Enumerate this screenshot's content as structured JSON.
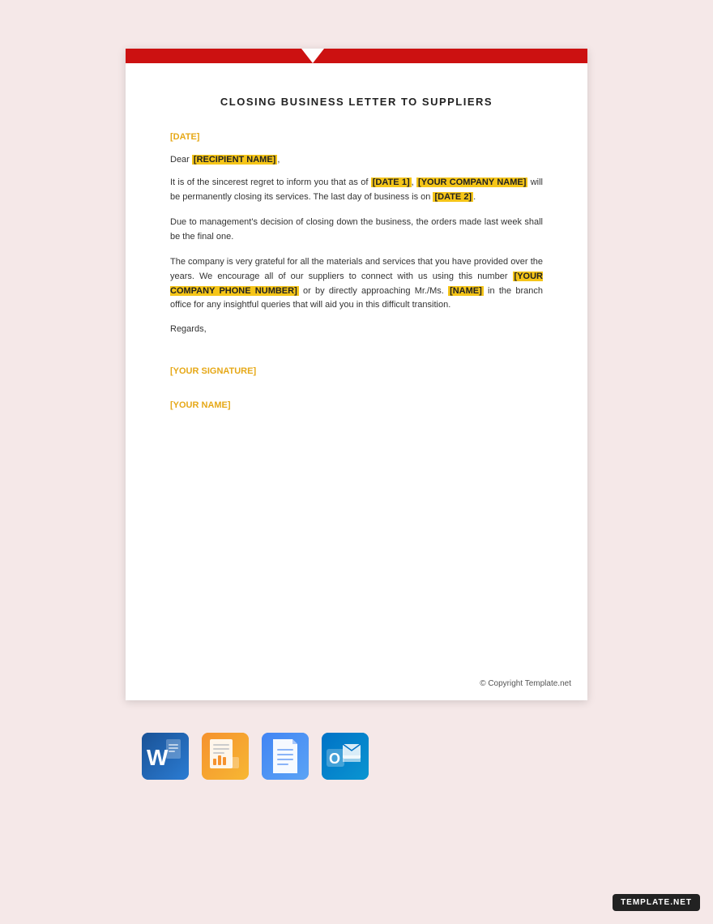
{
  "document": {
    "title": "CLOSING BUSINESS LETTER TO SUPPLIERS",
    "date_label": "[DATE]",
    "salutation_before": "Dear ",
    "recipient": "[RECIPIENT NAME]",
    "salutation_after": ",",
    "paragraph1_before": "It is of the sincerest regret to inform you that as of ",
    "date1": "[DATE 1]",
    "paragraph1_mid1": ", ",
    "company_name": "[YOUR COMPANY NAME]",
    "paragraph1_mid2": " will be permanently closing its services. The last day of business is on ",
    "date2": "[DATE 2]",
    "paragraph1_end": ".",
    "paragraph2": "Due to management's decision of closing down the business, the orders made last week shall be the final one.",
    "paragraph3_before": "The company is very grateful for all the materials and services that you have provided over the years. We encourage all of our suppliers to connect with us using this  number ",
    "phone": "[YOUR COMPANY PHONE NUMBER]",
    "paragraph3_mid": " or by directly approaching Mr./Ms. ",
    "name": "[NAME]",
    "paragraph3_end": " in the branch office for any insightful queries that will aid you in this difficult transition.",
    "regards": "Regards,",
    "signature_label": "[YOUR SIGNATURE]",
    "name_label": "[YOUR NAME]",
    "footer": "© Copyright Template.net"
  },
  "app_icons": [
    {
      "name": "microsoft-word",
      "label": "Word"
    },
    {
      "name": "apple-pages",
      "label": "Pages"
    },
    {
      "name": "google-docs",
      "label": "Docs"
    },
    {
      "name": "microsoft-outlook",
      "label": "Outlook"
    }
  ],
  "badge": {
    "label": "TEMPLATE.NET"
  }
}
